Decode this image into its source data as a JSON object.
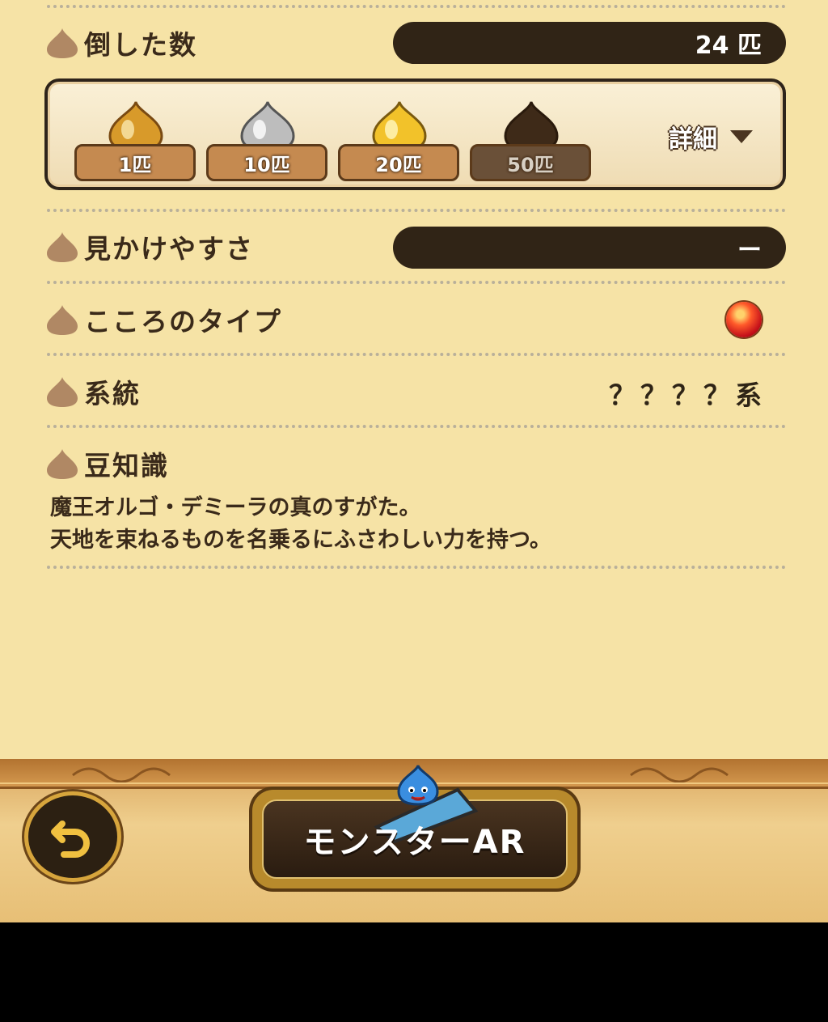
{
  "rows": {
    "defeated": {
      "label": "倒した数",
      "value": "24 匹"
    },
    "visibility": {
      "label": "見かけやすさ",
      "value": "ー"
    },
    "heart_type": {
      "label": "こころのタイプ",
      "orb_color": "#d8141e"
    },
    "lineage": {
      "label": "系統",
      "value": "？？？？系"
    },
    "trivia": {
      "label": "豆知識",
      "line1": "魔王オルゴ・デミーラの真のすがた。",
      "line2": "天地を束ねるものを名乗るにふさわしい力を持つ。"
    }
  },
  "medals": [
    {
      "label": "1匹",
      "tier": "bronze",
      "color": "#e0a03a"
    },
    {
      "label": "10匹",
      "tier": "silver",
      "color": "#c9c9c9"
    },
    {
      "label": "20匹",
      "tier": "gold",
      "color": "#f3c83a"
    },
    {
      "label": "50匹",
      "tier": "locked",
      "color": "#4a3422"
    }
  ],
  "detail_button": {
    "label": "詳細"
  },
  "footer": {
    "back_icon": "back-arrow-icon",
    "ar_button": "モンスターAR"
  },
  "colors": {
    "background": "#f6e3a6",
    "pill": "#302416",
    "text": "#3a2a1a"
  }
}
